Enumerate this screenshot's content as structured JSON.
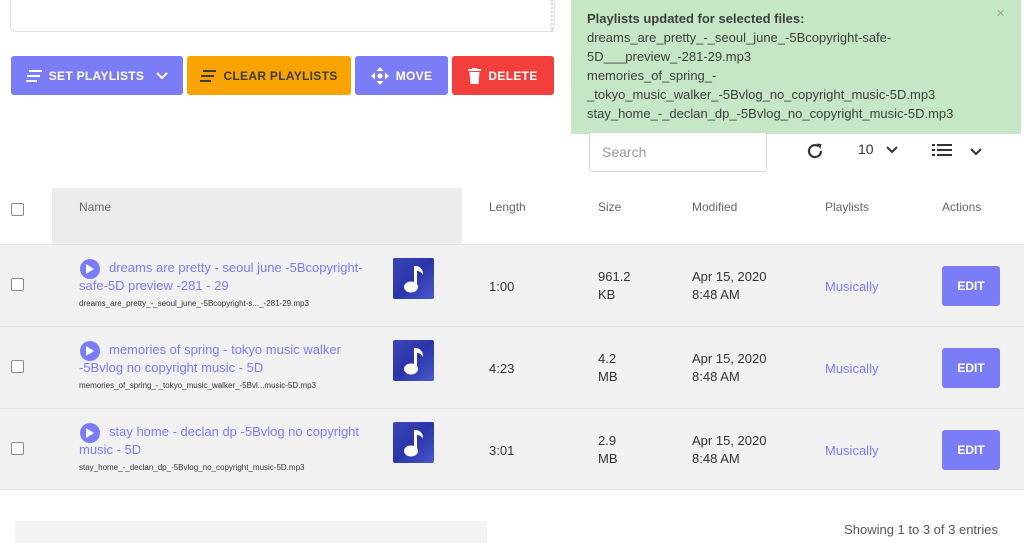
{
  "toolbar": {
    "set_playlists": "SET PLAYLISTS",
    "clear_playlists": "CLEAR PLAYLISTS",
    "move": "MOVE",
    "delete": "DELETE"
  },
  "notification": {
    "title": "Playlists updated for selected files:",
    "lines": [
      "dreams_are_pretty_-_seoul_june_-5Bcopyright-safe-",
      "5D___preview_-281-29.mp3",
      "memories_of_spring_-",
      "_tokyo_music_walker_-5Bvlog_no_copyright_music-5D.mp3",
      "stay_home_-_declan_dp_-5Bvlog_no_copyright_music-5D.mp3"
    ],
    "close": "×"
  },
  "controls": {
    "search_placeholder": "Search",
    "page_size": "10"
  },
  "table": {
    "headers": {
      "name": "Name",
      "length": "Length",
      "size": "Size",
      "modified": "Modified",
      "playlists": "Playlists",
      "actions": "Actions"
    },
    "rows": [
      {
        "title": "dreams are pretty - seoul june -5Bcopyright-safe-5D preview -281 - 29",
        "file": "dreams_are_pretty_-_seoul_june_-5Bcopyright-s..._-281-29.mp3",
        "length": "1:00",
        "size_value": "961.2",
        "size_unit": "KB",
        "modified_date": "Apr 15, 2020",
        "modified_time": "8:48 AM",
        "playlist": "Musically",
        "edit": "EDIT"
      },
      {
        "title": "memories of spring - tokyo music walker -5Bvlog no copyright music - 5D",
        "file": "memories_of_spring_-_tokyo_music_walker_-5Bvl...music-5D.mp3",
        "length": "4:23",
        "size_value": "4.2",
        "size_unit": "MB",
        "modified_date": "Apr 15, 2020",
        "modified_time": "8:48 AM",
        "playlist": "Musically",
        "edit": "EDIT"
      },
      {
        "title": "stay home - declan dp -5Bvlog no copyright music - 5D",
        "file": "stay_home_-_declan_dp_-5Bvlog_no_copyright_music-5D.mp3",
        "length": "3:01",
        "size_value": "2.9",
        "size_unit": "MB",
        "modified_date": "Apr 15, 2020",
        "modified_time": "8:48 AM",
        "playlist": "Musically",
        "edit": "EDIT"
      }
    ]
  },
  "footer": {
    "showing": "Showing 1 to 3 of 3 entries"
  },
  "colors": {
    "accent": "#7b7df6",
    "warning": "#f9a300",
    "danger": "#f23f3c",
    "success_bg": "#c6e7c5"
  },
  "icons": {
    "set_playlists": "list-icon",
    "clear_playlists": "list-icon",
    "move": "arrows-move-icon",
    "delete": "trash-icon",
    "play": "play-icon",
    "thumb": "music-note-icon",
    "refresh": "refresh-icon",
    "view": "list-view-icon"
  }
}
